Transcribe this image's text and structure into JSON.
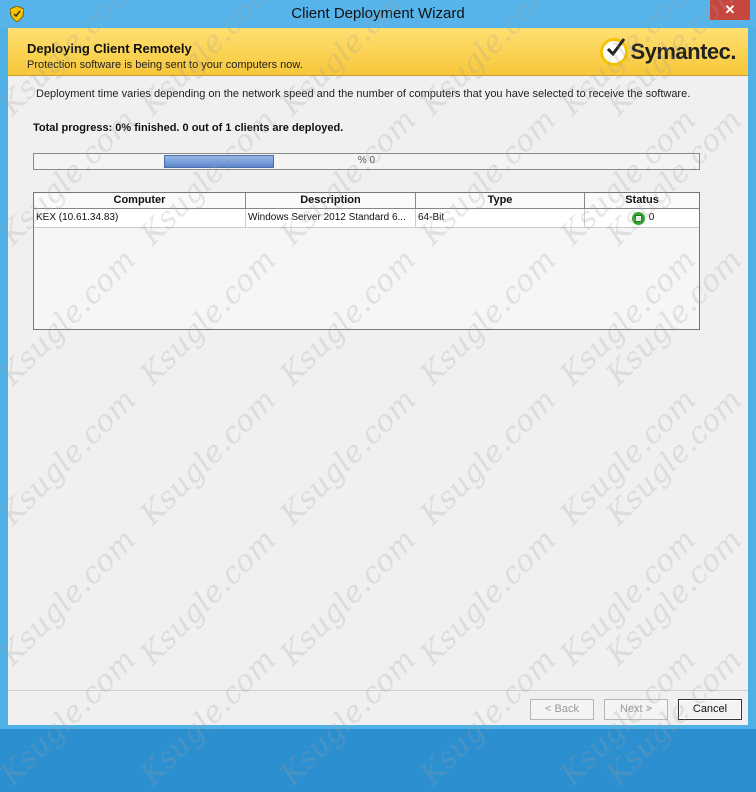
{
  "window": {
    "title": "Client Deployment Wizard",
    "close_label": "✕"
  },
  "header": {
    "title": "Deploying Client Remotely",
    "subtitle": "Protection software is being sent to your computers now.",
    "brand": "Symantec."
  },
  "info_text": "Deployment time varies depending on the network speed and the number of computers that you have selected to receive the software.",
  "progress": {
    "summary": "Total progress:  0% finished.  0 out of 1 clients are deployed.",
    "label": "% 0"
  },
  "table": {
    "columns": [
      "Computer",
      "Description",
      "Type",
      "Status"
    ],
    "rows": [
      {
        "computer": "KEX (10.61.34.83)",
        "description": "Windows Server 2012 Standard 6...",
        "type": "64-Bit",
        "status": "0"
      }
    ]
  },
  "buttons": {
    "back": "< Back",
    "next": "Next >",
    "cancel": "Cancel"
  },
  "watermark": "Ksugle.com",
  "colors": {
    "title_bar": "#56b4ea",
    "header_bg": "#f7c73a",
    "status_ok": "#2ea52e",
    "progress_fill": "#5d88cf"
  }
}
